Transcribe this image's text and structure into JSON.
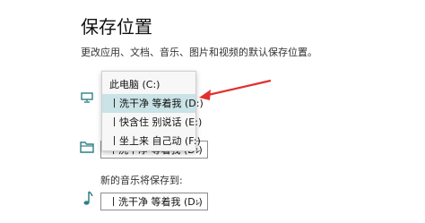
{
  "header": {
    "title": "保存位置",
    "subtitle": "更改应用、文档、音乐、图片和视频的默认保存位置。"
  },
  "dropdown_menu": {
    "items": [
      "此电脑 (C:)",
      "丨洗干净 等着我 (D:)",
      "丨快含住 别说话 (E:)",
      "丨坐上来 自己动 (F:)"
    ],
    "selected_index": 1
  },
  "rows": [
    {
      "icon": "monitor-icon"
    },
    {
      "icon": "folder-icon",
      "value": "丨洗干净 等着我 (D:)"
    },
    {
      "icon": "music-note-icon",
      "label": "新的音乐将保存到:",
      "value": "丨洗干净 等着我 (D:)"
    }
  ],
  "annotation": {
    "arrow_color": "#e0312e"
  },
  "colors": {
    "accent": "#2f7f86",
    "selected_bg": "#c9e3e6"
  }
}
